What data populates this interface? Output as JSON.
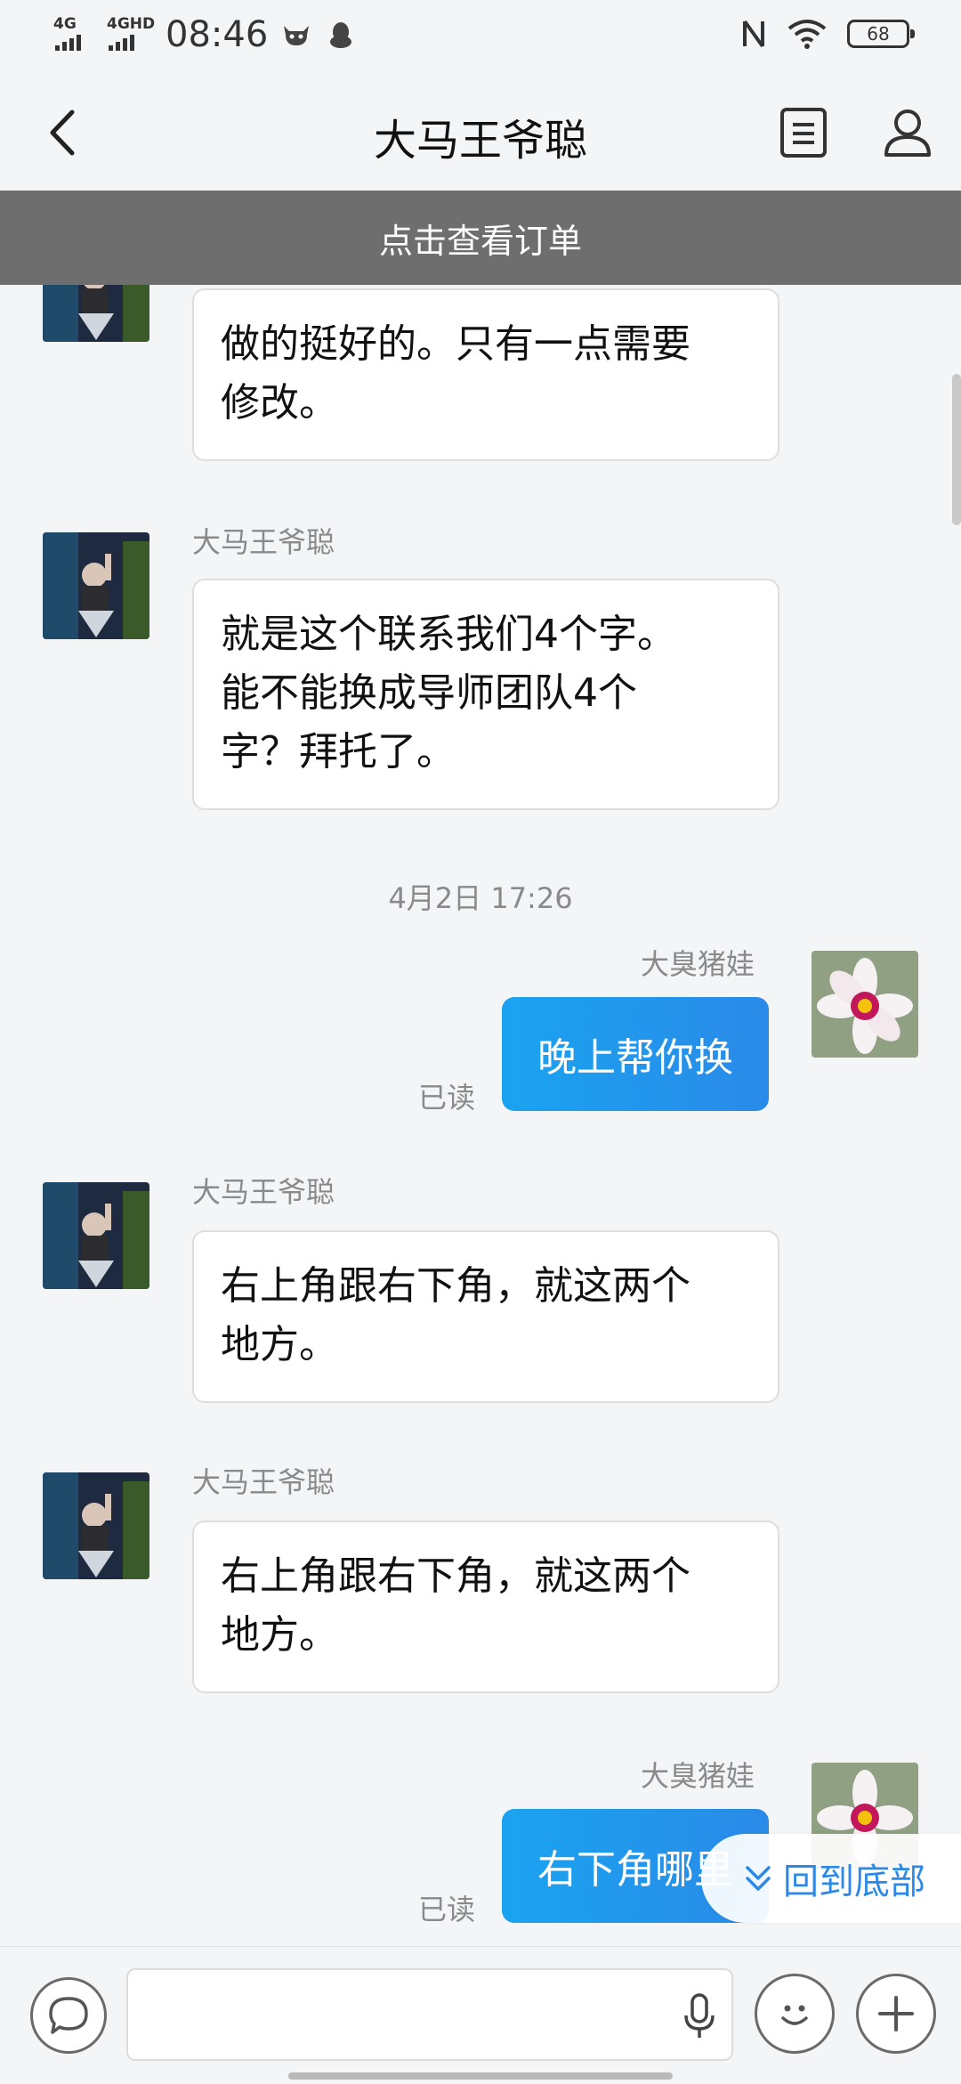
{
  "status_bar": {
    "network1": "4G",
    "network2": "4GHD",
    "time": "08:46",
    "battery": "68",
    "icons": [
      "cow-icon",
      "qq-penguin-icon",
      "nfc-icon",
      "wifi-icon",
      "battery-icon"
    ]
  },
  "header": {
    "title": "大马王爷聪",
    "icons": [
      "back-arrow-icon",
      "document-icon",
      "user-profile-icon"
    ]
  },
  "banner": {
    "text": "点击查看订单"
  },
  "messages": [
    {
      "from": "other",
      "sender": "",
      "text_lines": [
        "做的挺好的。只有一点需要",
        "修改。"
      ]
    },
    {
      "from": "other",
      "sender": "大马王爷聪",
      "text_lines": [
        "就是这个联系我们4个字。",
        "能不能换成导师团队4个",
        "字？拜托了。"
      ]
    },
    {
      "type": "time",
      "text": "4月2日 17:26"
    },
    {
      "from": "self",
      "sender": "大臭猪娃",
      "text": "晚上帮你换",
      "status": "已读"
    },
    {
      "from": "other",
      "sender": "大马王爷聪",
      "text_lines": [
        "右上角跟右下角，就这两个",
        "地方。"
      ]
    },
    {
      "from": "other",
      "sender": "大马王爷聪",
      "text_lines": [
        "右上角跟右下角，就这两个",
        "地方。"
      ]
    },
    {
      "from": "self",
      "sender": "大臭猪娃",
      "text": "右下角哪里",
      "status": "已读"
    }
  ],
  "scroll_to_bottom": {
    "label": "回到底部"
  },
  "input": {
    "value": "",
    "placeholder": ""
  },
  "colors": {
    "accent": "#2a8ae8",
    "bubble_out": "#1aa3f0",
    "banner": "#6e6e6e",
    "background": "#f4f5f7"
  }
}
